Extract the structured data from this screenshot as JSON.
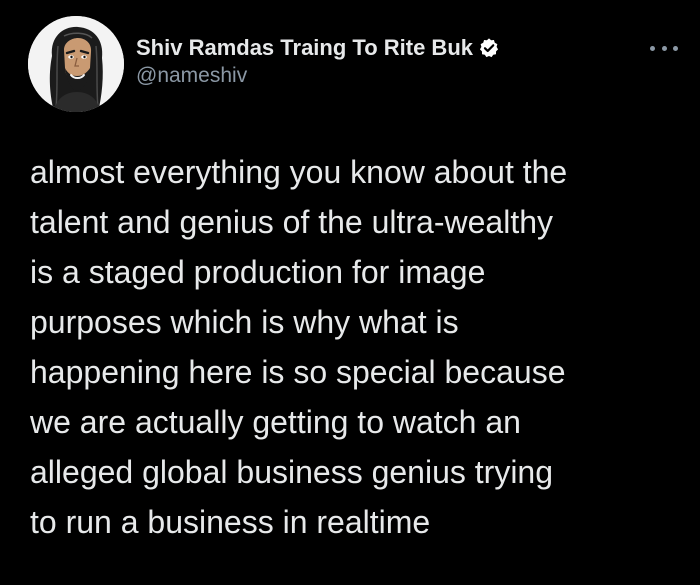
{
  "author": {
    "display_name": "Shiv Ramdas Traing To Rite Buk",
    "handle": "@nameshiv",
    "verified": true,
    "avatar_icon": "cartoon-portrait-avatar"
  },
  "menu": {
    "icon": "more-options-icon"
  },
  "tweet": {
    "lines": [
      "almost everything you know about the",
      "talent and genius of the ultra-wealthy",
      "is a staged production for image",
      "purposes which is why what is",
      "happening here is so special because",
      "we are actually getting to watch an",
      "alleged global business genius trying",
      "to run a business in realtime"
    ]
  },
  "colors": {
    "background": "#000000",
    "text": "#e7e9ea",
    "secondary": "#8b98a5",
    "verified_badge": "#ffffff"
  }
}
